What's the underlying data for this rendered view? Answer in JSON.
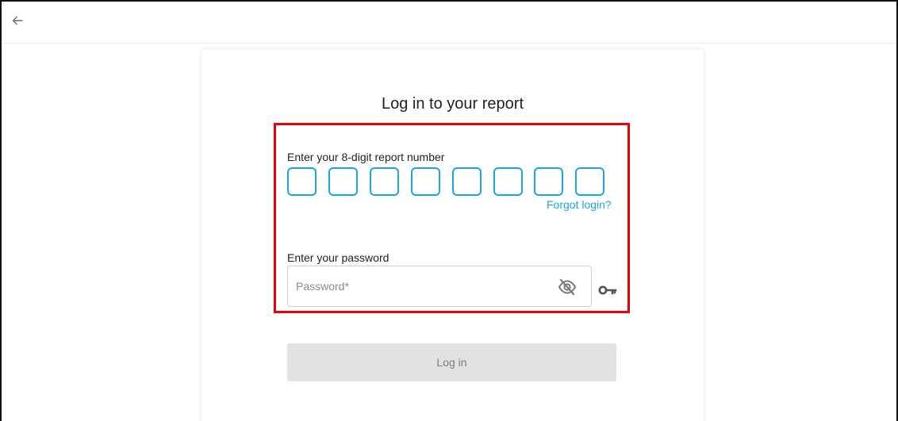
{
  "nav": {
    "back_icon": "arrow-left-icon"
  },
  "login": {
    "title": "Log in to your report",
    "report_number_label": "Enter your 8-digit report number",
    "digits": [
      "",
      "",
      "",
      "",
      "",
      "",
      "",
      ""
    ],
    "forgot_login": "Forgot login?",
    "password_label": "Enter your password",
    "password_placeholder": "Password*",
    "password_value": "",
    "toggle_visibility_icon": "eye-off-icon",
    "password_manager_icon": "key-icon",
    "submit_label": "Log in"
  },
  "colors": {
    "accent": "#1aa6e6",
    "highlight_border": "#e8000b",
    "disabled_button_bg": "#e2e2e2",
    "disabled_button_text": "#7d7d7d"
  }
}
